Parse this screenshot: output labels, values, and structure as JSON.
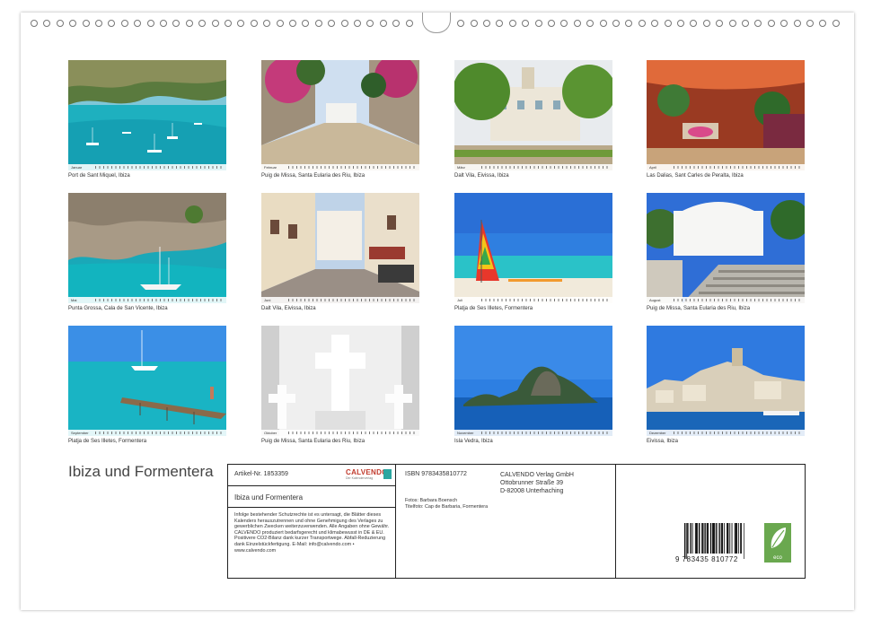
{
  "calendar": {
    "title": "Ibiza und Formentera",
    "months": [
      {
        "month": "Januar",
        "caption": "Port de Sant Miquel, Ibiza",
        "scene": "bay-boats"
      },
      {
        "month": "Februar",
        "caption": "Puig de Missa, Santa Eularia des Riu, Ibiza",
        "scene": "alley-flowers"
      },
      {
        "month": "März",
        "caption": "Dalt Vila, Eivissa, Ibiza",
        "scene": "palms-square"
      },
      {
        "month": "April",
        "caption": "Las Dalias, Sant Carles de Peralta, Ibiza",
        "scene": "market"
      },
      {
        "month": "Mai",
        "caption": "Punta Grossa, Cala de San Vicente, Ibiza",
        "scene": "cliff-sailboat"
      },
      {
        "month": "Juni",
        "caption": "Dalt Vila, Eivissa, Ibiza",
        "scene": "street"
      },
      {
        "month": "Juli",
        "caption": "Platja de Ses Illetes, Formentera",
        "scene": "beach-sail"
      },
      {
        "month": "August",
        "caption": "Puig de Missa, Santa Eularia des Riu, Ibiza",
        "scene": "church-stairs"
      },
      {
        "month": "September",
        "caption": "Platja de Ses Illetes, Formentera",
        "scene": "jetty"
      },
      {
        "month": "Oktober",
        "caption": "Puig de Missa, Santa Eularia des Riu, Ibiza",
        "scene": "crosses"
      },
      {
        "month": "November",
        "caption": "Isla Vedra, Ibiza",
        "scene": "island"
      },
      {
        "month": "Dezember",
        "caption": "Eivissa, Ibiza",
        "scene": "old-town"
      }
    ]
  },
  "info": {
    "article": "Artikel-Nr. 1853359",
    "subtitle": "Ibiza und Formentera",
    "legal": "Infolge bestehender Schutzrechte ist es untersagt, die Blätter dieses Kalenders herauszutrennen und ohne Genehmigung des Verlages zu gewerblichen Zwecken weiterzuverwenden. Alle Angaben ohne Gewähr. CALVENDO produziert bedarfsgerecht und klimabewusst in DE & EU. Positivere CO2-Bilanz dank kurzer Transportwege. Abfall-Reduzierung dank Einzelstückfertigung. E-Mail: info@calvendo.com • www.calvendo.com",
    "isbn": "ISBN 9783435810772",
    "publisher_line1": "CALVENDO Verlag GmbH",
    "publisher_line2": "Ottobrunner Straße 39",
    "publisher_line3": "D-82008 Unterhaching",
    "photos_line1": "Fotos: Barbara Boensch",
    "photos_line2": "Titelfoto: Cap de Barbaria, Formentera",
    "barcode_number": "9 783435 810772",
    "logo_text": "CALVENDO",
    "logo_sub": "Der Kalenderverlag",
    "eco_text": "eco"
  }
}
